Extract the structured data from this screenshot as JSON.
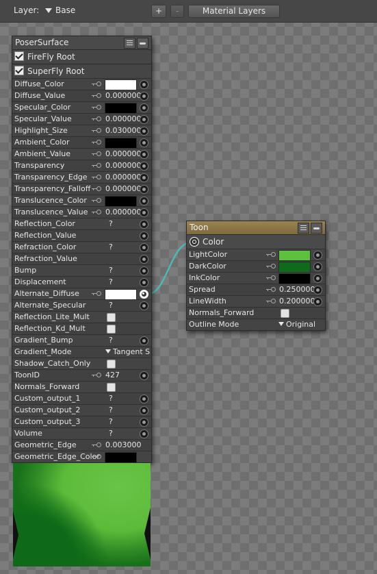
{
  "toolbar": {
    "layer_label": "Layer:",
    "layer_value": "Base",
    "add_label": "+",
    "remove_label": "-",
    "material_layers_label": "Material Layers"
  },
  "poser_surface": {
    "title": "PoserSurface",
    "roots": [
      {
        "label": "FireFly Root",
        "checked": true
      },
      {
        "label": "SuperFly Root",
        "checked": true
      }
    ],
    "rows": [
      {
        "label": "Diffuse_Color",
        "kind": "color",
        "color": "#ffffff",
        "key": true,
        "plug": true
      },
      {
        "label": "Diffuse_Value",
        "kind": "value",
        "value": "0.000000",
        "key": true,
        "plug": true
      },
      {
        "label": "Specular_Color",
        "kind": "color",
        "color": "#000000",
        "key": true,
        "plug": true
      },
      {
        "label": "Specular_Value",
        "kind": "value",
        "value": "0.000000",
        "key": true,
        "plug": true
      },
      {
        "label": "Highlight_Size",
        "kind": "value",
        "value": "0.030000",
        "key": true,
        "plug": true
      },
      {
        "label": "Ambient_Color",
        "kind": "color",
        "color": "#000000",
        "key": true,
        "plug": true
      },
      {
        "label": "Ambient_Value",
        "kind": "value",
        "value": "0.000000",
        "key": true,
        "plug": true
      },
      {
        "label": "Transparency",
        "kind": "value",
        "value": "0.000000",
        "key": true,
        "plug": true
      },
      {
        "label": "Transparency_Edge",
        "kind": "value",
        "value": "0.000000",
        "key": true,
        "plug": true
      },
      {
        "label": "Transparency_Falloff",
        "kind": "value",
        "value": "0.000000",
        "key": true,
        "plug": true
      },
      {
        "label": "Translucence_Color",
        "kind": "color",
        "color": "#000000",
        "key": true,
        "plug": true
      },
      {
        "label": "Translucence_Value",
        "kind": "value",
        "value": "0.000000",
        "key": true,
        "plug": true
      },
      {
        "label": "Reflection_Color",
        "kind": "q",
        "value": "?",
        "key": false,
        "plug": true
      },
      {
        "label": "Reflection_Value",
        "kind": "none",
        "key": false,
        "plug": true
      },
      {
        "label": "Refraction_Color",
        "kind": "q",
        "value": "?",
        "key": false,
        "plug": true
      },
      {
        "label": "Refraction_Value",
        "kind": "none",
        "key": false,
        "plug": true
      },
      {
        "label": "Bump",
        "kind": "q",
        "value": "?",
        "key": false,
        "plug": true
      },
      {
        "label": "Displacement",
        "kind": "q",
        "value": "?",
        "key": false,
        "plug": true
      },
      {
        "label": "Alternate_Diffuse",
        "kind": "color",
        "color": "#ffffff",
        "key": true,
        "plug": true,
        "linked": true
      },
      {
        "label": "Alternate_Specular",
        "kind": "q",
        "value": "?",
        "key": false,
        "plug": true
      },
      {
        "label": "Reflection_Lite_Mult",
        "kind": "check",
        "key": false,
        "plug": false
      },
      {
        "label": "Reflection_Kd_Mult",
        "kind": "check",
        "key": false,
        "plug": false
      },
      {
        "label": "Gradient_Bump",
        "kind": "q",
        "value": "?",
        "key": false,
        "plug": true
      },
      {
        "label": "Gradient_Mode",
        "kind": "dropdown",
        "value": "Tangent S",
        "key": false,
        "plug": false
      },
      {
        "label": "Shadow_Catch_Only",
        "kind": "check",
        "key": false,
        "plug": false
      },
      {
        "label": "ToonID",
        "kind": "value",
        "value": "427",
        "key": true,
        "plug": true
      },
      {
        "label": "Normals_Forward",
        "kind": "check",
        "key": false,
        "plug": false
      },
      {
        "label": "Custom_output_1",
        "kind": "q",
        "value": "?",
        "key": false,
        "plug": true
      },
      {
        "label": "Custom_output_2",
        "kind": "q",
        "value": "?",
        "key": false,
        "plug": true
      },
      {
        "label": "Custom_output_3",
        "kind": "q",
        "value": "?",
        "key": false,
        "plug": true
      },
      {
        "label": "Volume",
        "kind": "q",
        "value": "?",
        "key": false,
        "plug": true
      },
      {
        "label": "Geometric_Edge",
        "kind": "value",
        "value": "0.003000",
        "key": true,
        "plug": false
      },
      {
        "label": "Geometric_Edge_Color",
        "kind": "color",
        "color": "#000000",
        "key": true,
        "plug": false
      }
    ]
  },
  "toon": {
    "title": "Toon",
    "output_label": "Color",
    "rows": [
      {
        "label": "LightColor",
        "kind": "color",
        "color": "#5cc23e",
        "key": true,
        "plug": true
      },
      {
        "label": "DarkColor",
        "kind": "color",
        "color": "#0f6a1a",
        "key": true,
        "plug": true
      },
      {
        "label": "InkColor",
        "kind": "color",
        "color": "#000000",
        "key": true,
        "plug": true
      },
      {
        "label": "Spread",
        "kind": "value",
        "value": "0.250000",
        "key": true,
        "plug": true
      },
      {
        "label": "LineWidth",
        "kind": "value",
        "value": "0.200000",
        "key": true,
        "plug": true
      },
      {
        "label": "Normals_Forward",
        "kind": "check",
        "key": false,
        "plug": false
      },
      {
        "label": "Outline Mode",
        "kind": "dropdown",
        "value": "Original",
        "key": false,
        "plug": false
      }
    ]
  },
  "link_color": "#4db8b8"
}
